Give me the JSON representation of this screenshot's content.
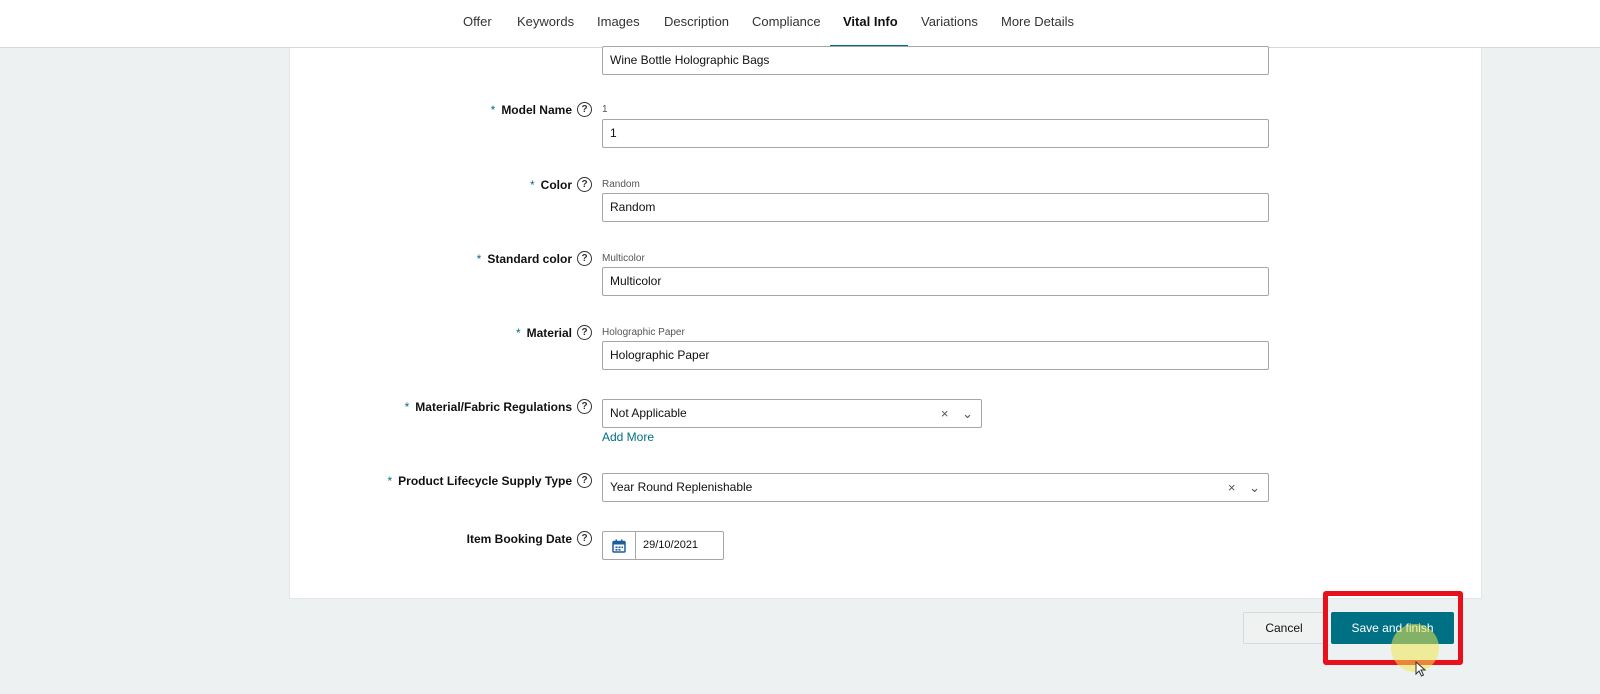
{
  "nav": {
    "tabs": [
      {
        "label": "Offer"
      },
      {
        "label": "Keywords"
      },
      {
        "label": "Images"
      },
      {
        "label": "Description"
      },
      {
        "label": "Compliance"
      },
      {
        "label": "Vital Info"
      },
      {
        "label": "Variations"
      },
      {
        "label": "More Details"
      }
    ],
    "active_tab": "Vital Info"
  },
  "form": {
    "top_field_value": "Wine Bottle Holographic Bags",
    "model_name": {
      "label": "Model Name",
      "required_mark": "*",
      "hint": "1",
      "value": "1"
    },
    "color": {
      "label": "Color",
      "required_mark": "*",
      "hint": "Random",
      "value": "Random"
    },
    "standard_color": {
      "label": "Standard color",
      "required_mark": "*",
      "hint": "Multicolor",
      "value": "Multicolor"
    },
    "material": {
      "label": "Material",
      "required_mark": "*",
      "hint": "Holographic Paper",
      "value": "Holographic Paper"
    },
    "material_fabric_regulations": {
      "label": "Material/Fabric Regulations",
      "required_mark": "*",
      "value": "Not Applicable",
      "add_more": "Add More"
    },
    "product_lifecycle_supply_type": {
      "label": "Product Lifecycle Supply Type",
      "required_mark": "*",
      "value": "Year Round Replenishable"
    },
    "item_booking_date": {
      "label": "Item Booking Date",
      "value": "29/10/2021"
    }
  },
  "icons": {
    "help": "?",
    "clear": "×",
    "chevron": "⌄"
  },
  "actions": {
    "cancel_label": "Cancel",
    "save_label": "Save and finish"
  },
  "colors": {
    "accent": "#007185",
    "highlight": "#e8101a",
    "background": "#eef1f1"
  }
}
